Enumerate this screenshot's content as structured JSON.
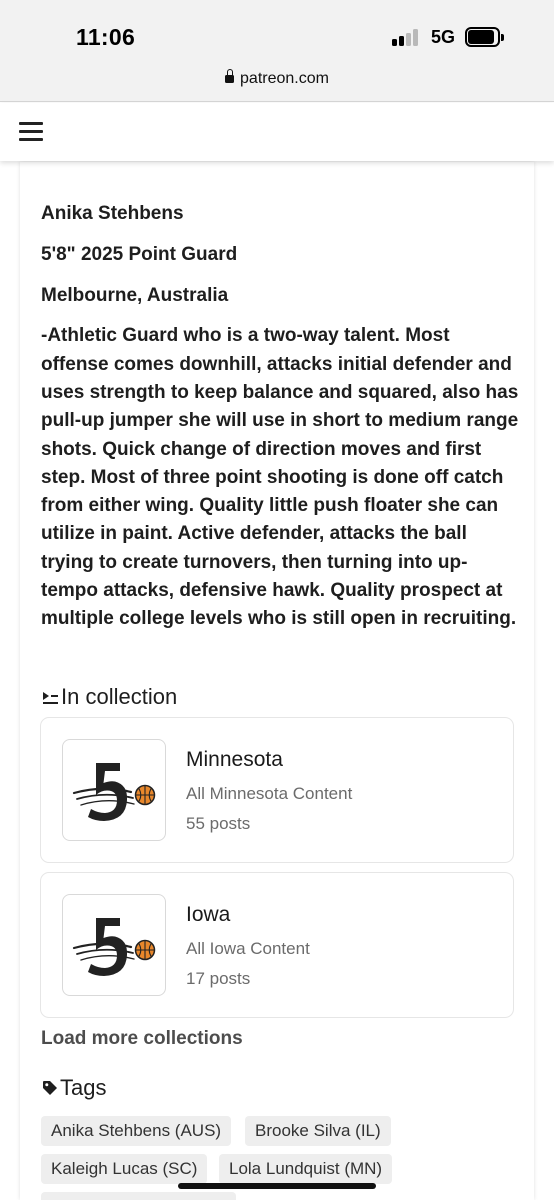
{
  "status_bar": {
    "time": "11:06",
    "network": "5G"
  },
  "browser": {
    "url": "patreon.com"
  },
  "post": {
    "name_line": "Anika Stehbens",
    "position_line": "5'8\" 2025 Point Guard",
    "location_line": "Melbourne, Australia",
    "description": "-Athletic Guard who is a two-way talent. Most offense comes downhill, attacks initial defender and uses strength to keep balance and squared, also has pull-up jumper she will use in short to medium range shots. Quick change of direction moves and first step. Most of three point shooting is done off catch from either wing. Quality little push floater she can utilize in paint. Active defender, attacks the ball trying to create turnovers, then turning into up-tempo attacks, defensive hawk. Quality prospect at multiple college levels who is still open in recruiting."
  },
  "collections": {
    "heading": "In collection",
    "items": [
      {
        "title": "Minnesota",
        "subtitle": "All Minnesota Content",
        "count": "55 posts"
      },
      {
        "title": "Iowa",
        "subtitle": "All Iowa Content",
        "count": "17 posts"
      }
    ],
    "load_more": "Load more collections"
  },
  "tags": {
    "heading": "Tags",
    "items": [
      "Anika Stehbens (AUS)",
      "Brooke Silva (IL)",
      "Kaleigh Lucas (SC)",
      "Lola Lundquist (MN)"
    ]
  },
  "colors": {
    "basketball": "#e8872b",
    "logo_dark": "#222222",
    "tag_bg": "#eeeeee"
  }
}
